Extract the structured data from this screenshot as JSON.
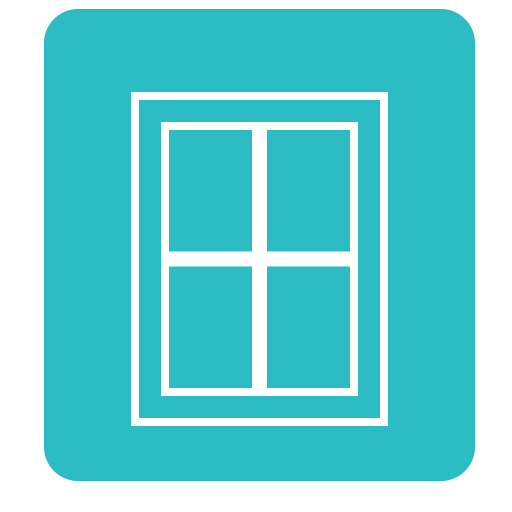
{
  "app_icon": {
    "icon": "window-icon",
    "background_color": "#2bbcc4",
    "foreground_color": "#ffffff"
  }
}
